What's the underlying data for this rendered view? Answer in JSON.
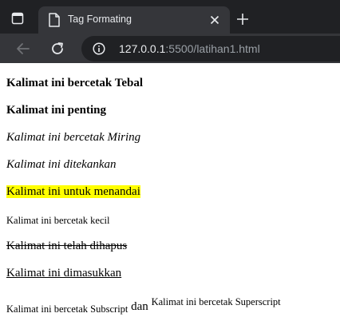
{
  "browser": {
    "tab": {
      "title": "Tag Formating"
    },
    "address_bar": {
      "host": "127.0.0.1",
      "path": ":5500/latihan1.html"
    },
    "colors": {
      "tabstrip": "#202124",
      "toolbar": "#35363a",
      "text": "#e8eaed",
      "dim_text": "#9aa0a6"
    }
  },
  "content": {
    "bold": "Kalimat ini bercetak Tebal",
    "strong": "Kalimat ini penting",
    "italic": "Kalimat ini bercetak Miring",
    "em": "Kalimat ini ditekankan",
    "mark": "Kalimat ini untuk menandai",
    "small": "Kalimat ini bercetak kecil",
    "del": "Kalimat ini telah dihapus",
    "ins": "Kalimat ini dimasukkan",
    "subscript": "Kalimat ini bercetak Subscript",
    "connector": "dan",
    "superscript": "Kalimat ini bercetak Superscript",
    "highlight_color": "#ffff00"
  }
}
